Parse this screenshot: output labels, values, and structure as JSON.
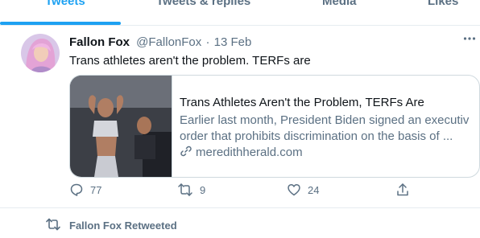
{
  "tabs": [
    {
      "label": "Tweets",
      "active": true
    },
    {
      "label": "Tweets & replies",
      "active": false
    },
    {
      "label": "Media",
      "active": false
    },
    {
      "label": "Likes",
      "active": false
    }
  ],
  "tweet": {
    "author_name": "Fallon Fox",
    "handle": "@FallonFox",
    "separator": "·",
    "date": "13 Feb",
    "text": "Trans athletes aren't the problem. TERFs are",
    "more_icon": "more-horizontal-icon",
    "card": {
      "title": "Trans Athletes Aren't the Problem, TERFs Are",
      "description_line1": "Earlier last month, President Biden signed an executive",
      "description_line2": "order that prohibits discrimination on the basis of ...",
      "domain": "meredithherald.com",
      "link_icon": "link-icon"
    },
    "actions": {
      "reply_count": "77",
      "retweet_count": "9",
      "like_count": "24"
    }
  },
  "retweet_context": {
    "label": "Fallon Fox Retweeted",
    "icon": "retweet-icon"
  },
  "colors": {
    "accent": "#1da1f2",
    "secondary_text": "#5b7083",
    "border": "#e6ecf0"
  }
}
